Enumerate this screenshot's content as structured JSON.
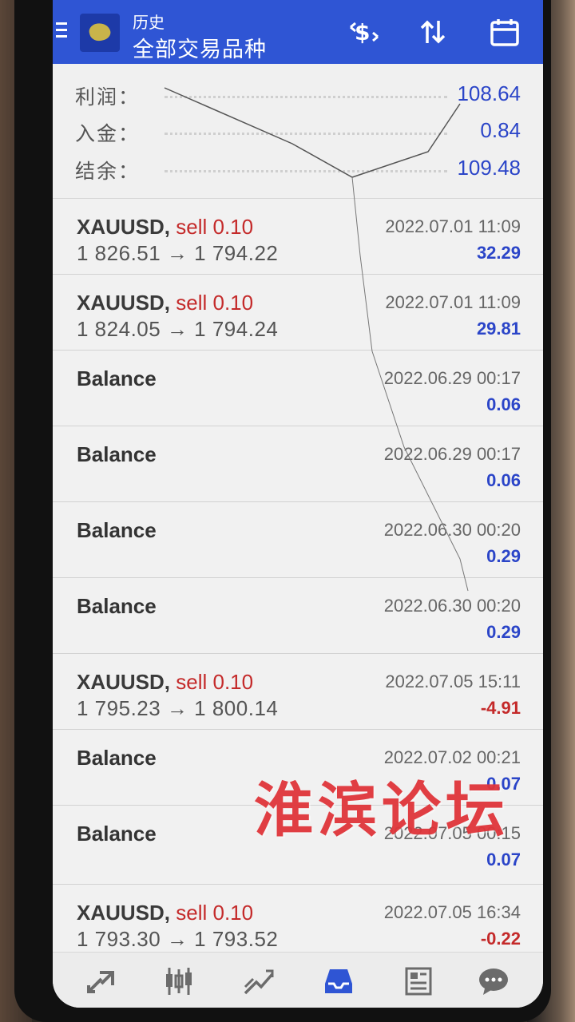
{
  "header": {
    "title": "历史",
    "subtitle": "全部交易品种",
    "icons": [
      "menu-icon",
      "app-logo",
      "dollar-swap-icon",
      "sort-icon",
      "calendar-icon"
    ]
  },
  "summary": [
    {
      "label": "利润：",
      "value": "108.64"
    },
    {
      "label": "入金：",
      "value": "0.84"
    },
    {
      "label": "结余：",
      "value": "109.48"
    }
  ],
  "deals": [
    {
      "kind": "trade",
      "symbol": "XAUUSD,",
      "side": "sell 0.10",
      "prices": "1 826.51 → 1 794.22",
      "time": "2022.07.01 11:09",
      "profit": "32.29",
      "sign": "pos"
    },
    {
      "kind": "trade",
      "symbol": "XAUUSD,",
      "side": "sell 0.10",
      "prices": "1 824.05 → 1 794.24",
      "time": "2022.07.01 11:09",
      "profit": "29.81",
      "sign": "pos"
    },
    {
      "kind": "balance",
      "title": "Balance",
      "time": "2022.06.29 00:17",
      "profit": "0.06",
      "sign": "pos"
    },
    {
      "kind": "balance",
      "title": "Balance",
      "time": "2022.06.29 00:17",
      "profit": "0.06",
      "sign": "pos"
    },
    {
      "kind": "balance",
      "title": "Balance",
      "time": "2022.06.30 00:20",
      "profit": "0.29",
      "sign": "pos"
    },
    {
      "kind": "balance",
      "title": "Balance",
      "time": "2022.06.30 00:20",
      "profit": "0.29",
      "sign": "pos"
    },
    {
      "kind": "trade",
      "symbol": "XAUUSD,",
      "side": "sell 0.10",
      "prices": "1 795.23 → 1 800.14",
      "time": "2022.07.05 15:11",
      "profit": "-4.91",
      "sign": "neg"
    },
    {
      "kind": "balance",
      "title": "Balance",
      "time": "2022.07.02 00:21",
      "profit": "0.07",
      "sign": "pos"
    },
    {
      "kind": "balance",
      "title": "Balance",
      "time": "2022.07.05 00:15",
      "profit": "0.07",
      "sign": "pos"
    },
    {
      "kind": "trade",
      "symbol": "XAUUSD,",
      "side": "sell 0.10",
      "prices": "1 793.30 → 1 793.52",
      "time": "2022.07.05 16:34",
      "profit": "-0.22",
      "sign": "neg"
    }
  ],
  "bottom_nav": [
    "quotes-icon",
    "chart-icon",
    "trade-icon",
    "history-icon",
    "news-icon",
    "chat-icon"
  ],
  "watermark": "淮滨论坛",
  "colors": {
    "header": "#2f55d4",
    "positive": "#2b45c8",
    "negative": "#c42a2a"
  }
}
